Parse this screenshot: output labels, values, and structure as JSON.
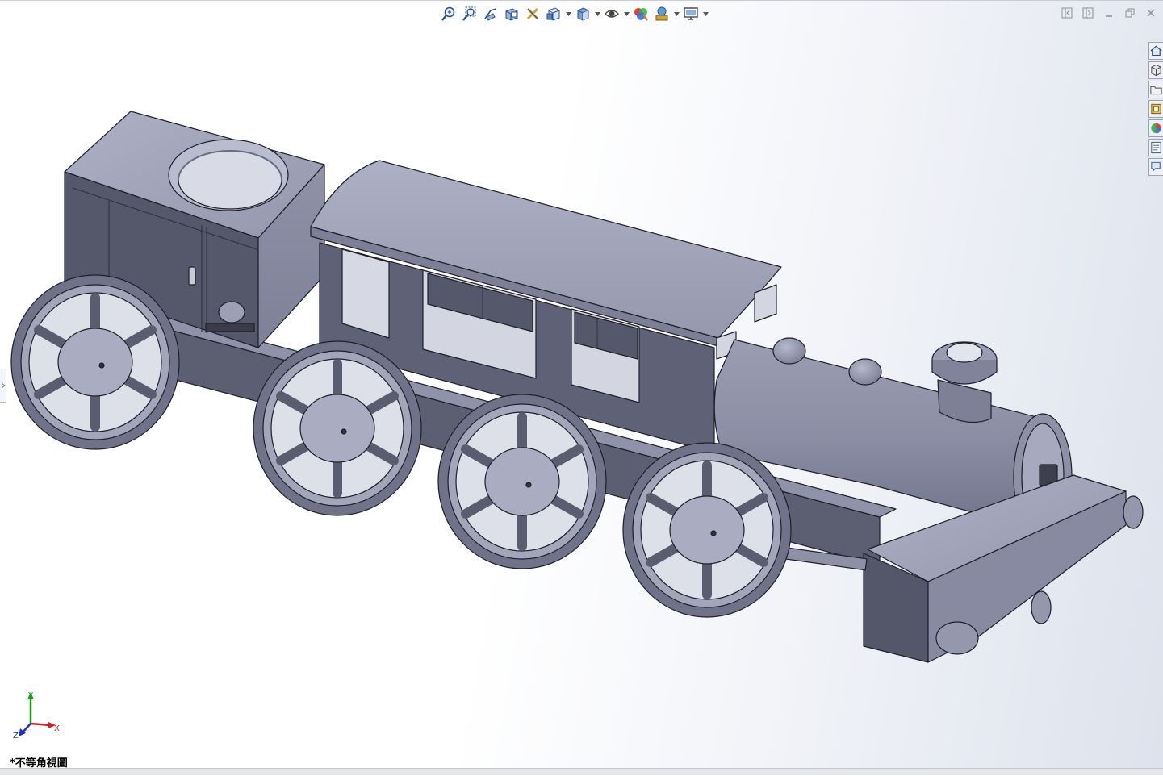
{
  "toolbar": {
    "items": [
      {
        "icon": "zoom-to-fit-icon",
        "dropdown": false
      },
      {
        "icon": "zoom-to-area-icon",
        "dropdown": false
      },
      {
        "icon": "previous-view-icon",
        "dropdown": false
      },
      {
        "icon": "section-view-icon",
        "dropdown": false
      },
      {
        "icon": "dynamic-annotation-icon",
        "dropdown": false
      },
      {
        "icon": "view-orientation-icon",
        "dropdown": true
      },
      {
        "icon": "display-style-icon",
        "dropdown": true
      },
      {
        "icon": "hide-show-items-icon",
        "dropdown": true
      },
      {
        "icon": "edit-appearance-icon",
        "dropdown": false
      },
      {
        "icon": "apply-scene-icon",
        "dropdown": true
      },
      {
        "icon": "view-settings-icon",
        "dropdown": true
      }
    ]
  },
  "window_controls": [
    "pane-left-icon",
    "pane-right-icon",
    "minimize-icon",
    "restore-icon",
    "close-icon"
  ],
  "task_pane": {
    "tabs": [
      "home-icon",
      "design-library-icon",
      "file-explorer-icon",
      "view-palette-icon",
      "appearances-icon",
      "custom-properties-icon",
      "forum-icon"
    ]
  },
  "triad": {
    "y_label": "Y",
    "x_label": "X",
    "z_label": "Z",
    "colors": {
      "x": "#d42020",
      "y": "#1a9a1a",
      "z": "#2030c8"
    }
  },
  "view": {
    "orientation_label": "*不等角視圖"
  },
  "colors": {
    "model_light": "#a3a6bb",
    "model_mid": "#8a8da3",
    "model_dark": "#54566a",
    "edge": "#1e1f28"
  }
}
